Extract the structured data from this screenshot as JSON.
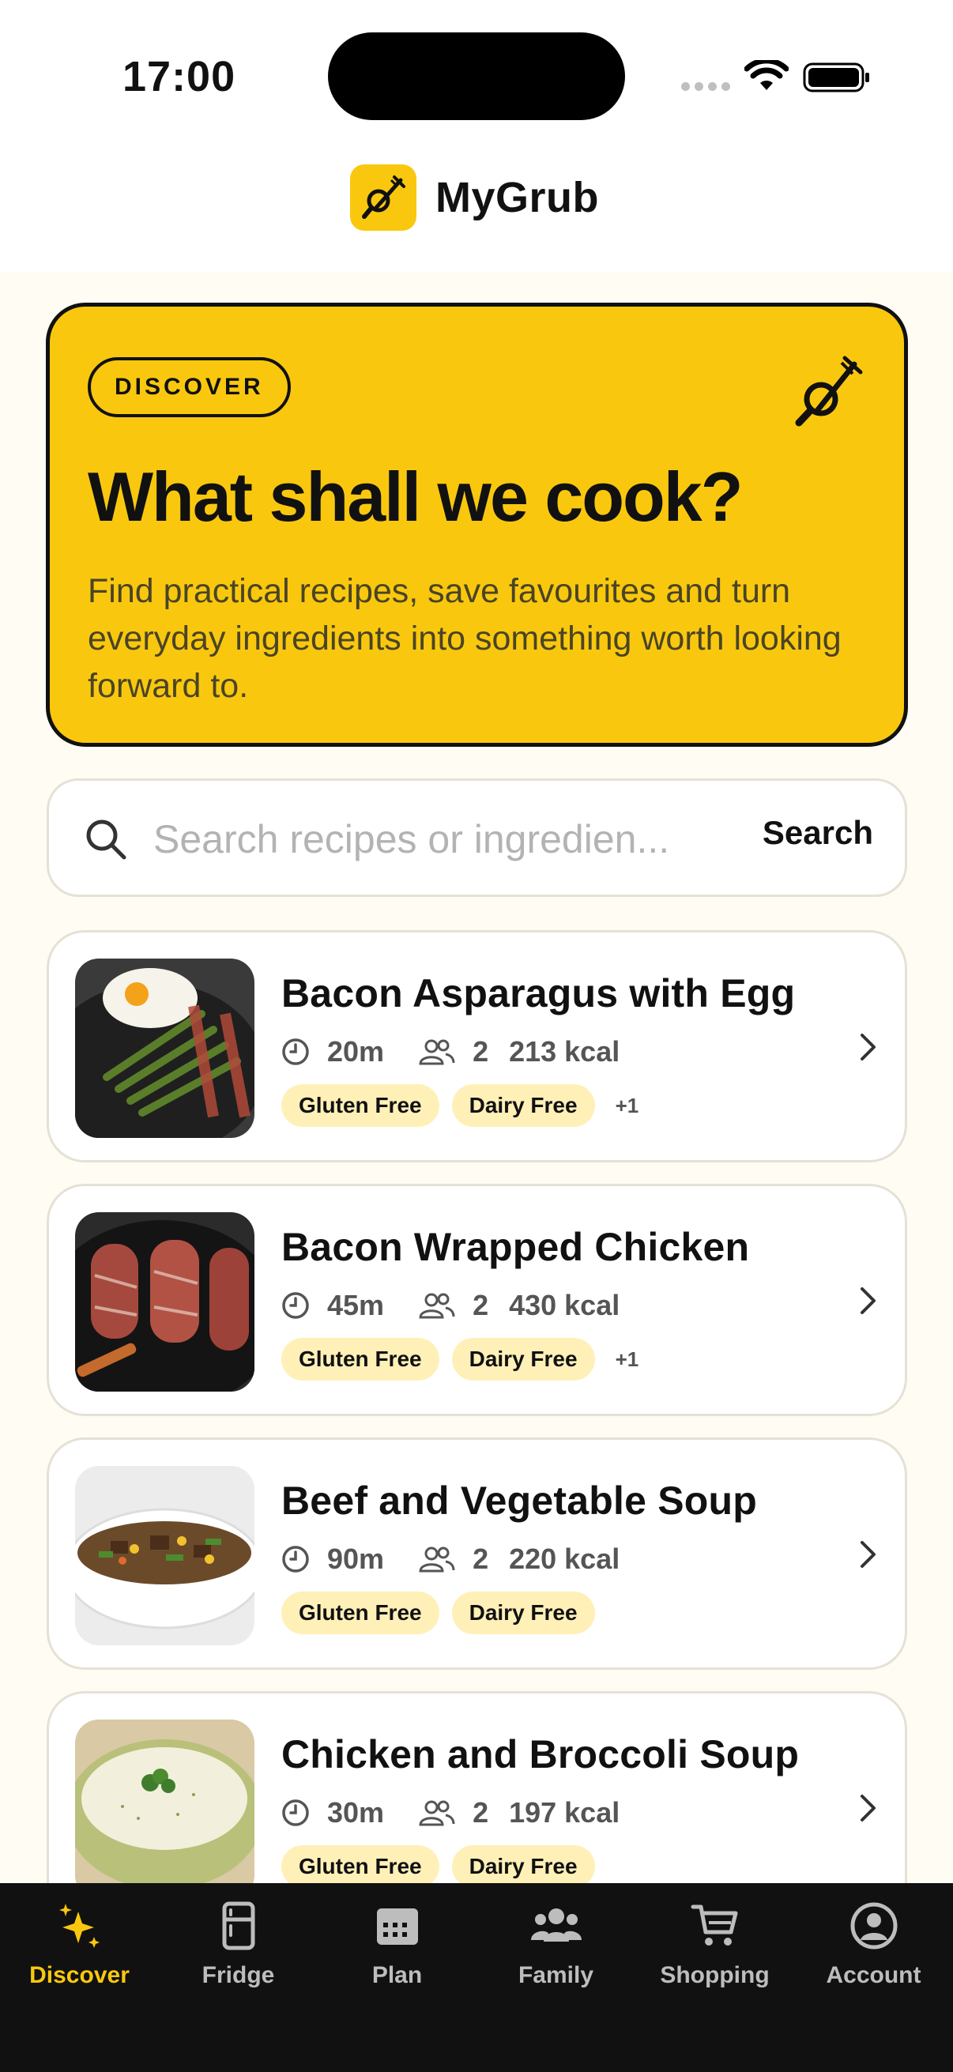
{
  "status_bar": {
    "time": "17:00"
  },
  "header": {
    "app_name": "MyGrub"
  },
  "hero": {
    "badge": "DISCOVER",
    "title": "What shall we cook?",
    "subtitle": "Find practical recipes, save favourites and turn everyday ingredients into something worth looking forward to."
  },
  "search": {
    "placeholder": "Search recipes or ingredien...",
    "button_label": "Search"
  },
  "recipes": [
    {
      "title": "Bacon Asparagus with Egg",
      "time": "20m",
      "servings": "2",
      "kcal": "213 kcal",
      "tags": [
        "Gluten Free",
        "Dairy Free"
      ],
      "more": "+1"
    },
    {
      "title": "Bacon Wrapped Chicken",
      "time": "45m",
      "servings": "2",
      "kcal": "430 kcal",
      "tags": [
        "Gluten Free",
        "Dairy Free"
      ],
      "more": "+1"
    },
    {
      "title": "Beef and Vegetable Soup",
      "time": "90m",
      "servings": "2",
      "kcal": "220 kcal",
      "tags": [
        "Gluten Free",
        "Dairy Free"
      ],
      "more": ""
    },
    {
      "title": "Chicken and Broccoli Soup",
      "time": "30m",
      "servings": "2",
      "kcal": "197 kcal",
      "tags": [
        "Gluten Free",
        "Dairy Free"
      ],
      "more": ""
    }
  ],
  "nav": [
    {
      "label": "Discover",
      "icon": "sparkles-icon",
      "active": true
    },
    {
      "label": "Fridge",
      "icon": "fridge-icon",
      "active": false
    },
    {
      "label": "Plan",
      "icon": "calendar-icon",
      "active": false
    },
    {
      "label": "Family",
      "icon": "family-icon",
      "active": false
    },
    {
      "label": "Shopping",
      "icon": "cart-icon",
      "active": false
    },
    {
      "label": "Account",
      "icon": "account-icon",
      "active": false
    }
  ],
  "colors": {
    "accent": "#F9C80E",
    "tag_bg": "#FFF0B8",
    "nav_bg": "#111111"
  }
}
